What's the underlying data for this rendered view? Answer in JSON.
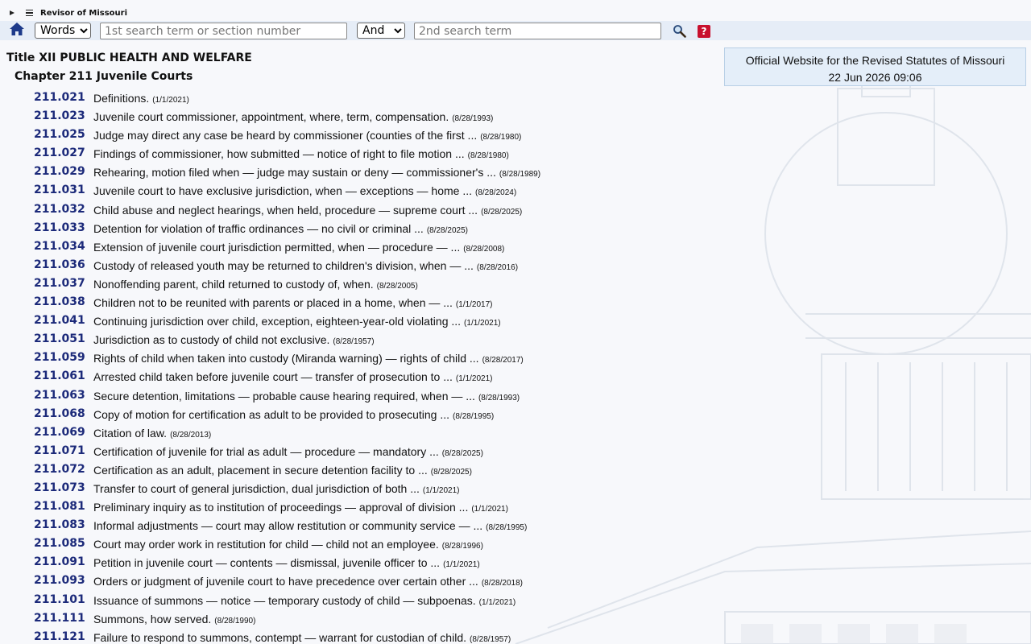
{
  "header": {
    "site_name": "Revisor of Missouri"
  },
  "search": {
    "mode_value": "Words",
    "mode_options": [
      "Words"
    ],
    "term1_placeholder": "1st search term or section number",
    "operator_value": "And",
    "operator_options": [
      "And"
    ],
    "term2_placeholder": "2nd search term",
    "help_label": "?"
  },
  "info": {
    "line1": "Official Website for the Revised Statutes of Missouri",
    "line2": "22 Jun 2026 09:06"
  },
  "heading": {
    "title": "Title XII PUBLIC HEALTH AND WELFARE",
    "chapter": "Chapter 211 Juvenile Courts"
  },
  "sections": [
    {
      "num": "211.021",
      "desc": "Definitions.",
      "date": "(1/1/2021)"
    },
    {
      "num": "211.023",
      "desc": "Juvenile court commissioner, appointment, where, term, compensation.",
      "date": "(8/28/1993)"
    },
    {
      "num": "211.025",
      "desc": "Judge may direct any case be heard by commissioner (counties of the first ...",
      "date": "(8/28/1980)"
    },
    {
      "num": "211.027",
      "desc": "Findings of commissioner, how submitted — notice of right to file motion ...",
      "date": "(8/28/1980)"
    },
    {
      "num": "211.029",
      "desc": "Rehearing, motion filed when — judge may sustain or deny — commissioner's ...",
      "date": "(8/28/1989)"
    },
    {
      "num": "211.031",
      "desc": "Juvenile court to have exclusive jurisdiction, when — exceptions — home ...",
      "date": "(8/28/2024)"
    },
    {
      "num": "211.032",
      "desc": "Child abuse and neglect hearings, when held, procedure — supreme court ...",
      "date": "(8/28/2025)"
    },
    {
      "num": "211.033",
      "desc": "Detention for violation of traffic ordinances — no civil or criminal ...",
      "date": "(8/28/2025)"
    },
    {
      "num": "211.034",
      "desc": "Extension of juvenile court jurisdiction permitted, when — procedure — ...",
      "date": "(8/28/2008)"
    },
    {
      "num": "211.036",
      "desc": "Custody of released youth may be returned to children's division, when — ...",
      "date": "(8/28/2016)"
    },
    {
      "num": "211.037",
      "desc": "Nonoffending parent, child returned to custody of, when.",
      "date": "(8/28/2005)"
    },
    {
      "num": "211.038",
      "desc": "Children not to be reunited with parents or placed in a home, when — ...",
      "date": "(1/1/2017)"
    },
    {
      "num": "211.041",
      "desc": "Continuing jurisdiction over child, exception, eighteen-year-old violating ...",
      "date": "(1/1/2021)"
    },
    {
      "num": "211.051",
      "desc": "Jurisdiction as to custody of child not exclusive.",
      "date": "(8/28/1957)"
    },
    {
      "num": "211.059",
      "desc": "Rights of child when taken into custody (Miranda warning) — rights of child ...",
      "date": "(8/28/2017)"
    },
    {
      "num": "211.061",
      "desc": "Arrested child taken before juvenile court — transfer of prosecution to ...",
      "date": "(1/1/2021)"
    },
    {
      "num": "211.063",
      "desc": "Secure detention, limitations — probable cause hearing required, when — ...",
      "date": "(8/28/1993)"
    },
    {
      "num": "211.068",
      "desc": "Copy of motion for certification as adult to be provided to prosecuting ...",
      "date": "(8/28/1995)"
    },
    {
      "num": "211.069",
      "desc": "Citation of law.",
      "date": "(8/28/2013)"
    },
    {
      "num": "211.071",
      "desc": "Certification of juvenile for trial as adult — procedure — mandatory ...",
      "date": "(8/28/2025)"
    },
    {
      "num": "211.072",
      "desc": "Certification as an adult, placement in secure detention facility to ...",
      "date": "(8/28/2025)"
    },
    {
      "num": "211.073",
      "desc": "Transfer to court of general jurisdiction, dual jurisdiction of both ...",
      "date": "(1/1/2021)"
    },
    {
      "num": "211.081",
      "desc": "Preliminary inquiry as to institution of proceedings — approval of division ...",
      "date": "(1/1/2021)"
    },
    {
      "num": "211.083",
      "desc": "Informal adjustments — court may allow restitution or community service — ...",
      "date": "(8/28/1995)"
    },
    {
      "num": "211.085",
      "desc": "Court may order work in restitution for child — child not an employee.",
      "date": "(8/28/1996)"
    },
    {
      "num": "211.091",
      "desc": "Petition in juvenile court — contents — dismissal, juvenile officer to ...",
      "date": "(1/1/2021)"
    },
    {
      "num": "211.093",
      "desc": "Orders or judgment of juvenile court to have precedence over certain other ...",
      "date": "(8/28/2018)"
    },
    {
      "num": "211.101",
      "desc": "Issuance of summons — notice — temporary custody of child — subpoenas.",
      "date": "(1/1/2021)"
    },
    {
      "num": "211.111",
      "desc": "Summons, how served.",
      "date": "(8/28/1990)"
    },
    {
      "num": "211.121",
      "desc": "Failure to respond to summons, contempt — warrant for custodian of child.",
      "date": "(8/28/1957)"
    }
  ]
}
